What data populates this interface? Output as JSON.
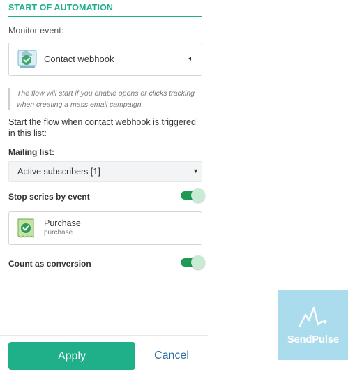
{
  "section_title": "START OF AUTOMATION",
  "monitor_event": {
    "label": "Monitor event:",
    "selected": "Contact webhook",
    "icon": "contact-webhook-icon"
  },
  "hint": "The flow will start if you enable opens or clicks tracking when creating a mass email campaign.",
  "start_text": "Start the flow when contact webhook is triggered in this list:",
  "mailing_list": {
    "label": "Mailing list:",
    "selected": "Active subscribers [1]"
  },
  "stop_series": {
    "label": "Stop series by event",
    "enabled": true
  },
  "event_card": {
    "title": "Purchase",
    "subtitle": "purchase",
    "icon": "receipt-check-icon"
  },
  "count_conversion": {
    "label": "Count as conversion",
    "enabled": true
  },
  "buttons": {
    "apply": "Apply",
    "cancel": "Cancel"
  },
  "brand": {
    "name": "SendPulse",
    "bg": "#abdcee"
  },
  "colors": {
    "accent": "#20b089",
    "toggle_on": "#1f9a55",
    "link": "#2b6aa6"
  }
}
